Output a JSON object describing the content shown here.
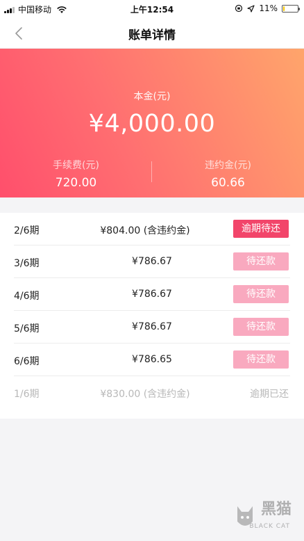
{
  "status_bar": {
    "carrier": "中国移动",
    "time": "上午12:54",
    "battery_text": "11%",
    "battery_level": 0.11
  },
  "nav": {
    "title": "账单详情",
    "back_icon": "chevron-left-icon"
  },
  "summary": {
    "principal_label": "本金(元)",
    "principal_amount": "¥4,000.00",
    "fee_label": "手续费(元)",
    "fee_value": "720.00",
    "penalty_label": "违约金(元)",
    "penalty_value": "60.66"
  },
  "installments": [
    {
      "period": "2/6期",
      "amount": "¥804.00 (含违约金)",
      "status": "逾期待还",
      "state": "overdue"
    },
    {
      "period": "3/6期",
      "amount": "¥786.67",
      "status": "待还款",
      "state": "pending"
    },
    {
      "period": "4/6期",
      "amount": "¥786.67",
      "status": "待还款",
      "state": "pending"
    },
    {
      "period": "5/6期",
      "amount": "¥786.67",
      "status": "待还款",
      "state": "pending"
    },
    {
      "period": "6/6期",
      "amount": "¥786.65",
      "status": "待还款",
      "state": "pending"
    },
    {
      "period": "1/6期",
      "amount": "¥830.00 (含违约金)",
      "status": "逾期已还",
      "state": "paid"
    }
  ],
  "watermark": {
    "brand": "黑猫",
    "sub": "BLACK CAT"
  },
  "colors": {
    "overdue_pill": "#f2456a",
    "pending_pill": "#f9a9bf",
    "gradient_start": "#ff4f6c",
    "gradient_end": "#ffa56b"
  }
}
